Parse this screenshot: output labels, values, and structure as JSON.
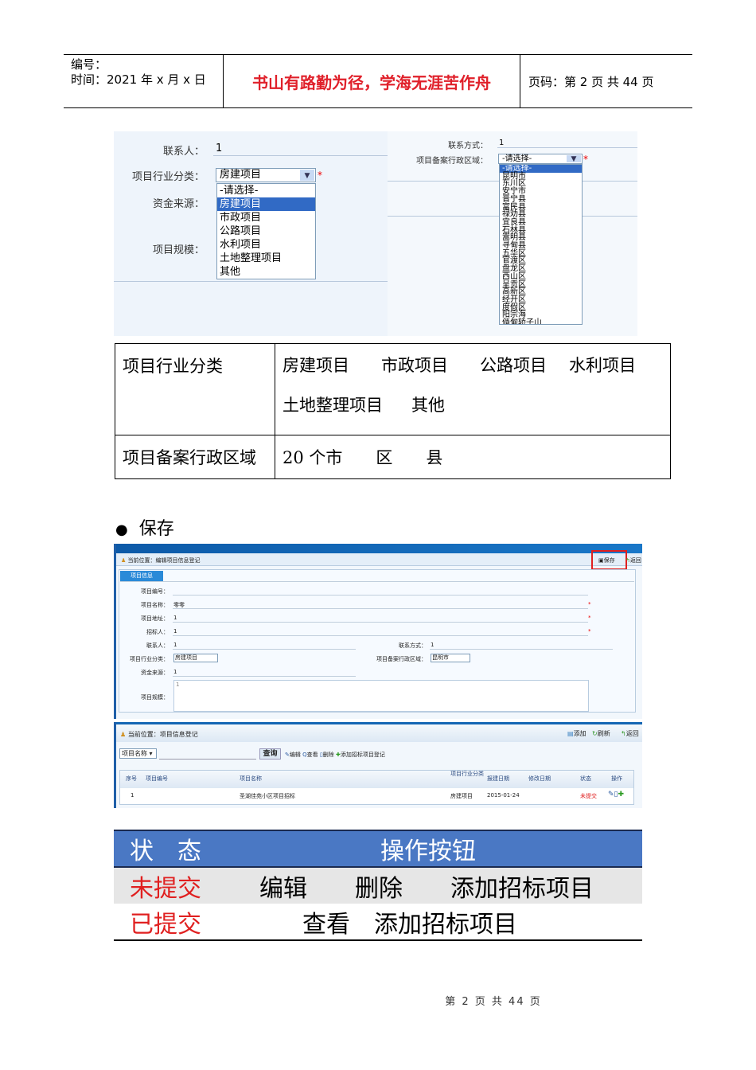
{
  "header": {
    "number_label": "编号：",
    "time_label": "时间：2021 年 x 月 x 日",
    "motto": "书山有路勤为径，学海无涯苦作舟",
    "page_label": "页码：第 2 页  共 44 页"
  },
  "shot1": {
    "contact_label": "联系人：",
    "contact_value": "1",
    "industry_label": "项目行业分类：",
    "industry_selected": "房建项目",
    "fund_label": "资金来源：",
    "scale_label": "项目规模：",
    "industry_options": [
      "-请选择-",
      "房建项目",
      "市政项目",
      "公路项目",
      "水利项目",
      "土地整理项目",
      "其他"
    ],
    "contact_method_label": "联系方式：",
    "contact_method_value": "1",
    "region_label": "项目备案行政区域：",
    "region_selected": "-请选择-",
    "region_options": [
      "-请选择-",
      "昆明市",
      "东川区",
      "安宁市",
      "晋宁县",
      "富民县",
      "禄劝县",
      "宜良县",
      "石林县",
      "嵩明县",
      "寻甸县",
      "五华区",
      "官渡区",
      "盘龙区",
      "西山区",
      "呈贡区",
      "高新区",
      "经开区",
      "度假区",
      "阳宗海",
      "倘甸轿子山"
    ]
  },
  "table1": {
    "row1_label": "项目行业分类",
    "row1_items": [
      "房建项目",
      "市政项目",
      "公路项目",
      "水利项目",
      "土地整理项目",
      "其他"
    ],
    "row2_label": "项目备案行政区域",
    "row2_value": "20 个市　　区　　县"
  },
  "bullet": "保存",
  "shot2": {
    "location": "当前位置：编辑项目信息登记",
    "save": "保存",
    "back": "返回",
    "tab": "项目信息",
    "fields": [
      {
        "label": "项目编号：",
        "value": ""
      },
      {
        "label": "项目名称：",
        "value": "零零"
      },
      {
        "label": "项目地址：",
        "value": "1"
      },
      {
        "label": "招标人：",
        "value": "1"
      }
    ],
    "contact_label": "联系人：",
    "contact_value": "1",
    "method_label": "联系方式：",
    "method_value": "1",
    "industry_label": "项目行业分类：",
    "industry_value": "房建项目",
    "region_label": "项目备案行政区域：",
    "region_value": "昆明市",
    "fund_label": "资金来源：",
    "fund_value": "1",
    "scale_label": "项目规模：",
    "scale_value": "1"
  },
  "shot3": {
    "location": "当前位置：项目信息登记",
    "add": "添加",
    "refresh": "刷新",
    "back": "返回",
    "filter": "项目名称",
    "query": "查询",
    "legend": [
      "编辑",
      "查看",
      "删除",
      "添加招标项目登记"
    ],
    "columns": [
      "序号",
      "项目编号",
      "项目名称",
      "项目行业分类",
      "报建日期",
      "修改日期",
      "状态",
      "操作"
    ],
    "row": {
      "no": "1",
      "code": "",
      "name": "圣湖佳苑小区项目招标",
      "industry": "房建项目",
      "date": "2015-01-24",
      "modified": "",
      "status": "未提交"
    }
  },
  "table3": {
    "h1": "状　态",
    "h2": "操作按钮",
    "r1_status": "未提交",
    "r1_ops": "编辑　　删除　　添加招标项目",
    "r2_status": "已提交",
    "r2_ops": "查看　添加招标项目"
  },
  "footer": "第 2 页 共 44 页"
}
